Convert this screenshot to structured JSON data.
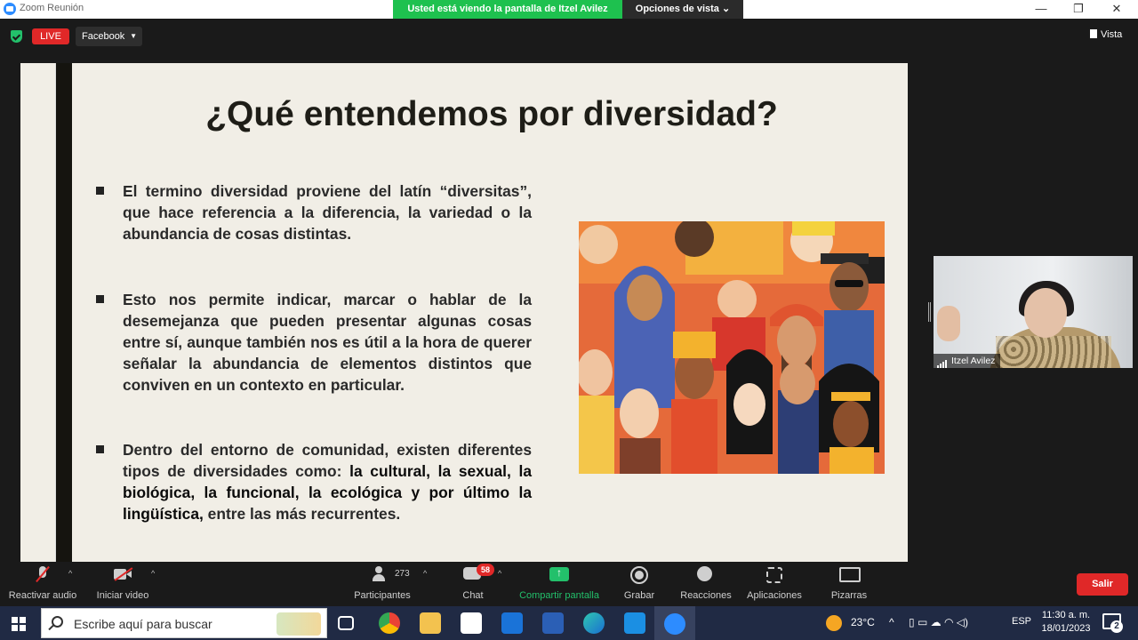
{
  "window": {
    "title": "Zoom Reunión",
    "share_banner": "Usted está viendo la pantalla de Itzel Avilez",
    "view_options": "Opciones de vista",
    "minimize": "—",
    "restore": "❐",
    "close": "✕"
  },
  "meeting_bar": {
    "live": "LIVE",
    "stream_target": "Facebook",
    "view": "Vista"
  },
  "slide": {
    "title": "¿Qué entendemos por diversidad?",
    "bullets": [
      {
        "text": "El termino diversidad proviene del latín “diversitas”, que hace referencia a la diferencia, la variedad o la abundancia de cosas distintas."
      },
      {
        "text": "Esto nos permite indicar, marcar o hablar de la desemejanza que pueden presentar algunas cosas entre sí, aunque también nos es útil a la hora de querer señalar la abundancia de elementos distintos que conviven en un contexto en particular."
      },
      {
        "text_before": "Dentro del entorno de comunidad, existen diferentes tipos de diversidades como: ",
        "text_strong": "la cultural, la sexual, la biológica, la funcional, la ecológica y por último la lingüística,",
        "text_after": " entre las más recurrentes."
      }
    ]
  },
  "participant": {
    "name": "Itzel Avilez"
  },
  "toolbar": {
    "audio": "Reactivar audio",
    "video": "Iniciar video",
    "participants": "Participantes",
    "participants_count": "273",
    "chat": "Chat",
    "chat_badge": "58",
    "share": "Compartir pantalla",
    "record": "Grabar",
    "reactions": "Reacciones",
    "apps": "Aplicaciones",
    "whiteboards": "Pizarras",
    "leave": "Salir"
  },
  "taskbar": {
    "search_placeholder": "Escribe aquí para buscar",
    "temperature": "23°C",
    "language": "ESP",
    "time": "11:30 a. m.",
    "date": "18/01/2023",
    "notifications": "2"
  },
  "colors": {
    "accent_green": "#1ec14f",
    "live_red": "#e02828",
    "slide_bg": "#f1eee6",
    "taskbar_bg": "#202a44"
  }
}
